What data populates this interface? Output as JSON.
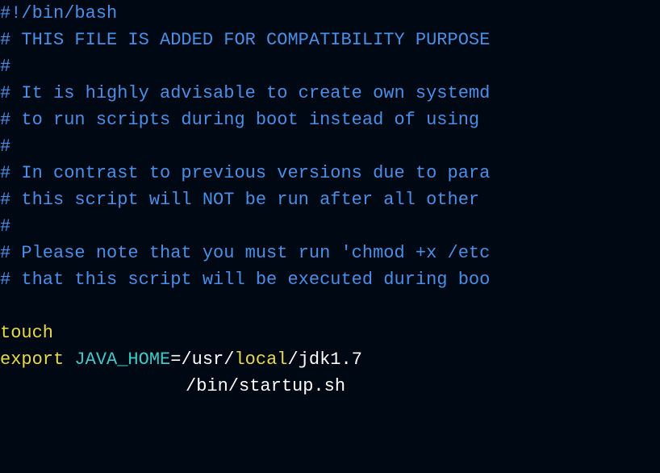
{
  "lines": {
    "l1": "#!/bin/bash",
    "l2": "# THIS FILE IS ADDED FOR COMPATIBILITY PURPOSE",
    "l3": "#",
    "l4": "# It is highly advisable to create own systemd",
    "l5": "# to run scripts during boot instead of using ",
    "l6": "#",
    "l7": "# In contrast to previous versions due to para",
    "l8": "# this script will NOT be run after all other ",
    "l9": "#",
    "l10": "# Please note that you must run 'chmod +x /etc",
    "l11": "# that this script will be executed during boo"
  },
  "cmd": {
    "touch": "touch ",
    "export": "export ",
    "javaHome": "JAVA_HOME",
    "equals": "=",
    "path1a": "/usr/",
    "path1b": "local",
    "path1c": "/jdk1.7",
    "startup": "/bin/startup.sh"
  }
}
